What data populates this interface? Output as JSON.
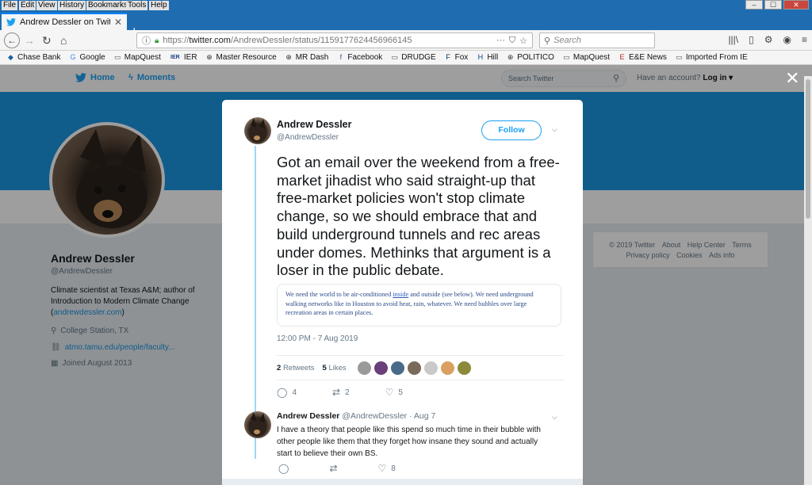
{
  "browser": {
    "menu": [
      "File",
      "Edit",
      "View",
      "History",
      "Bookmarks",
      "Tools",
      "Help"
    ],
    "window_controls": {
      "minimize": "–",
      "maximize": "☐",
      "close": "✕"
    },
    "tab_title": "Andrew Dessler on Twitter: \"Go",
    "tab_close": "✕",
    "new_tab": "+",
    "url_prefix": "https://",
    "url_main": "twitter.com",
    "url_rest": "/AndrewDessler/status/1159177624456966145",
    "search_placeholder": "Search",
    "bookmarks": [
      {
        "label": "Chase Bank",
        "icon": "chase-icon",
        "glyph": "◆",
        "color": "#1a5fa8"
      },
      {
        "label": "Google",
        "icon": "google-icon",
        "glyph": "G",
        "color": "#4285f4"
      },
      {
        "label": "MapQuest",
        "icon": "folder-icon",
        "glyph": "▭",
        "color": "#555555"
      },
      {
        "label": "IER",
        "icon": "ier-icon",
        "glyph": "IER",
        "color": "#1a3f8a"
      },
      {
        "label": "Master Resource",
        "icon": "globe-icon",
        "glyph": "⊕",
        "color": "#333333"
      },
      {
        "label": "MR Dash",
        "icon": "globe-icon",
        "glyph": "⊕",
        "color": "#333333"
      },
      {
        "label": "Facebook",
        "icon": "facebook-icon",
        "glyph": "f",
        "color": "#3b5998"
      },
      {
        "label": "DRUDGE",
        "icon": "folder-icon",
        "glyph": "▭",
        "color": "#555555"
      },
      {
        "label": "Fox",
        "icon": "fox-icon",
        "glyph": "F",
        "color": "#003366"
      },
      {
        "label": "Hill",
        "icon": "hill-icon",
        "glyph": "H",
        "color": "#0b3d91"
      },
      {
        "label": "POLITICO",
        "icon": "globe-icon",
        "glyph": "⊕",
        "color": "#333333"
      },
      {
        "label": "MapQuest",
        "icon": "folder-icon",
        "glyph": "▭",
        "color": "#555555"
      },
      {
        "label": "E&E News",
        "icon": "eenews-icon",
        "glyph": "E",
        "color": "#b22222"
      },
      {
        "label": "Imported From IE",
        "icon": "folder-icon",
        "glyph": "▭",
        "color": "#555555"
      }
    ]
  },
  "twitter": {
    "nav_home": "Home",
    "nav_moments": "Moments",
    "search_placeholder": "Search Twitter",
    "have_account": "Have an account?",
    "login": "Log in ▾",
    "close_glyph": "✕"
  },
  "profile": {
    "name": "Andrew Dessler",
    "handle": "@AndrewDessler",
    "bio": "Climate scientist at Texas A&M; author of Introduction to Modern Climate Change",
    "bio_link": "andrewdessler.com",
    "location": "College Station, TX",
    "website": "atmo.tamu.edu/people/faculty...",
    "joined": "Joined August 2013"
  },
  "footer": {
    "line1": [
      "© 2019 Twitter",
      "About",
      "Help Center",
      "Terms"
    ],
    "line2": [
      "Privacy policy",
      "Cookies",
      "Ads info"
    ]
  },
  "tweet": {
    "author_name": "Andrew Dessler",
    "author_handle": "@AndrewDessler",
    "follow_label": "Follow",
    "text": "Got an email over the weekend from a free-market jihadist who said straight-up that free-market policies won't stop climate change, so we should embrace that and build underground tunnels and rec areas under domes.  Methinks that argument is a loser in the public debate.",
    "quote_before": "We need the world to be air-conditioned ",
    "quote_link": "inside",
    "quote_after": " and outside (see below). We need underground walking networks like in Houston to avoid heat, rain, whatever. We need bubbles over large recreation areas in certain places.",
    "timestamp": "12:00 PM - 7 Aug 2019",
    "retweets_count": "2",
    "retweets_label": "Retweets",
    "likes_count": "5",
    "likes_label": "Likes",
    "likers_colors": [
      "#9a9a9a",
      "#6b3f7a",
      "#4a6a8a",
      "#7a6a5a",
      "#c9c9c9",
      "#d9a060",
      "#8a8a3a"
    ],
    "replies": "4",
    "retweets": "2",
    "likes": "5"
  },
  "reply": {
    "author_name": "Andrew Dessler",
    "author_handle": "@AndrewDessler",
    "date": "· Aug 7",
    "text": "I have a theory that people like this spend so much time in their bubble with other people like them that they forget how insane they sound and actually start to believe their own BS.",
    "replies": "",
    "retweets": "",
    "likes": "8"
  },
  "colors": {
    "twitter_blue": "#1da1f2",
    "banner": "#1b95e0",
    "firefox_tabbar": "#1f6db0"
  }
}
